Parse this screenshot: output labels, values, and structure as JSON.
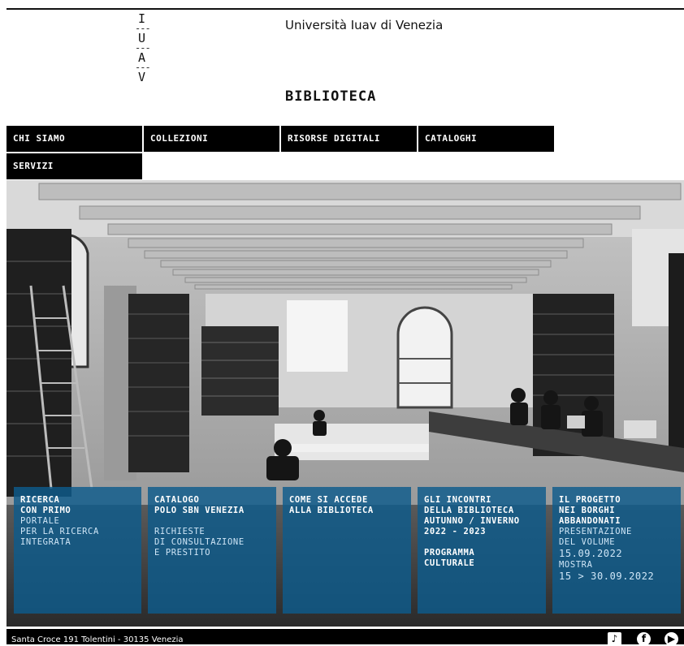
{
  "header": {
    "logo_letters": [
      "I",
      "U",
      "A",
      "V"
    ],
    "university": "Università Iuav di Venezia",
    "library": "BIBLIOTECA"
  },
  "menu": {
    "items": [
      "CHI SIAMO",
      "COLLEZIONI",
      "RISORSE DIGITALI",
      "CATALOGHI",
      "SERVIZI"
    ]
  },
  "tiles": [
    {
      "lines": [
        {
          "t": "RICERCA",
          "w": "b"
        },
        {
          "t": "CON PRIMO",
          "w": "b"
        },
        {
          "t": "PORTALE",
          "w": "n"
        },
        {
          "t": "PER LA RICERCA",
          "w": "n"
        },
        {
          "t": "INTEGRATA",
          "w": "n"
        }
      ]
    },
    {
      "lines": [
        {
          "t": "CATALOGO",
          "w": "b"
        },
        {
          "t": "POLO SBN VENEZIA",
          "w": "b"
        },
        {
          "t": "",
          "w": "gap"
        },
        {
          "t": "RICHIESTE",
          "w": "n"
        },
        {
          "t": "DI CONSULTAZIONE",
          "w": "n"
        },
        {
          "t": "E PRESTITO",
          "w": "n"
        }
      ]
    },
    {
      "lines": [
        {
          "t": "COME SI ACCEDE",
          "w": "b"
        },
        {
          "t": "ALLA BIBLIOTECA",
          "w": "b"
        }
      ]
    },
    {
      "lines": [
        {
          "t": "GLI INCONTRI",
          "w": "b"
        },
        {
          "t": "DELLA BIBLIOTECA",
          "w": "b"
        },
        {
          "t": "AUTUNNO / INVERNO",
          "w": "b"
        },
        {
          "t": "2022 - 2023",
          "w": "b"
        },
        {
          "t": "",
          "w": "gap"
        },
        {
          "t": "PROGRAMMA",
          "w": "b"
        },
        {
          "t": "CULTURALE",
          "w": "b"
        }
      ]
    },
    {
      "lines": [
        {
          "t": "IL PROGETTO",
          "w": "b"
        },
        {
          "t": "NEI BORGHI",
          "w": "b"
        },
        {
          "t": "ABBANDONATI",
          "w": "b"
        },
        {
          "t": "PRESENTAZIONE",
          "w": "n"
        },
        {
          "t": "DEL VOLUME",
          "w": "n"
        },
        {
          "t": "15.09.2022",
          "w": "n big"
        },
        {
          "t": "MOSTRA",
          "w": "n"
        },
        {
          "t": "15 > 30.09.2022",
          "w": "n big"
        }
      ]
    }
  ],
  "footer": {
    "address": "Santa Croce 191 Tolentini - 30135 Venezia",
    "social_icons": [
      "tiktok-icon",
      "facebook-icon",
      "youtube-icon"
    ]
  }
}
